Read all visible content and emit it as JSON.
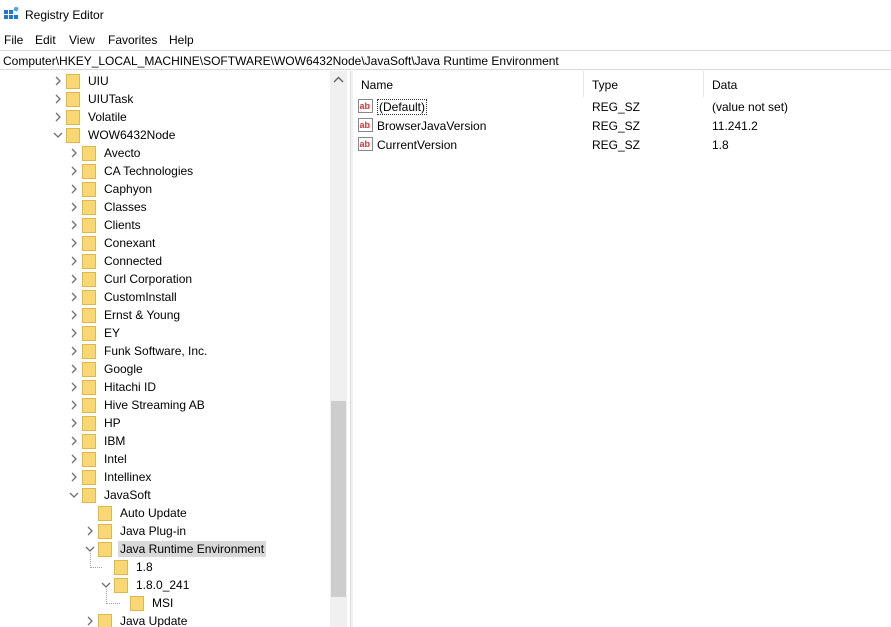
{
  "window": {
    "title": "Registry Editor"
  },
  "menu": [
    "File",
    "Edit",
    "View",
    "Favorites",
    "Help"
  ],
  "address": "Computer\\HKEY_LOCAL_MACHINE\\SOFTWARE\\WOW6432Node\\JavaSoft\\Java Runtime Environment",
  "tree": [
    {
      "label": "UIU",
      "depth": 0,
      "expander": "collapsed"
    },
    {
      "label": "UIUTask",
      "depth": 0,
      "expander": "collapsed"
    },
    {
      "label": "Volatile",
      "depth": 0,
      "expander": "collapsed"
    },
    {
      "label": "WOW6432Node",
      "depth": 0,
      "expander": "expanded"
    },
    {
      "label": "Avecto",
      "depth": 1,
      "expander": "collapsed"
    },
    {
      "label": "CA Technologies",
      "depth": 1,
      "expander": "collapsed"
    },
    {
      "label": "Caphyon",
      "depth": 1,
      "expander": "collapsed"
    },
    {
      "label": "Classes",
      "depth": 1,
      "expander": "collapsed"
    },
    {
      "label": "Clients",
      "depth": 1,
      "expander": "collapsed"
    },
    {
      "label": "Conexant",
      "depth": 1,
      "expander": "collapsed"
    },
    {
      "label": "Connected",
      "depth": 1,
      "expander": "collapsed"
    },
    {
      "label": "Curl Corporation",
      "depth": 1,
      "expander": "collapsed"
    },
    {
      "label": "CustomInstall",
      "depth": 1,
      "expander": "collapsed"
    },
    {
      "label": "Ernst & Young",
      "depth": 1,
      "expander": "collapsed"
    },
    {
      "label": "EY",
      "depth": 1,
      "expander": "collapsed"
    },
    {
      "label": "Funk Software, Inc.",
      "depth": 1,
      "expander": "collapsed"
    },
    {
      "label": "Google",
      "depth": 1,
      "expander": "collapsed"
    },
    {
      "label": "Hitachi ID",
      "depth": 1,
      "expander": "collapsed"
    },
    {
      "label": "Hive Streaming AB",
      "depth": 1,
      "expander": "collapsed"
    },
    {
      "label": "HP",
      "depth": 1,
      "expander": "collapsed"
    },
    {
      "label": "IBM",
      "depth": 1,
      "expander": "collapsed"
    },
    {
      "label": "Intel",
      "depth": 1,
      "expander": "collapsed"
    },
    {
      "label": "Intellinex",
      "depth": 1,
      "expander": "collapsed"
    },
    {
      "label": "JavaSoft",
      "depth": 1,
      "expander": "expanded"
    },
    {
      "label": "Auto Update",
      "depth": 2,
      "expander": "none"
    },
    {
      "label": "Java Plug-in",
      "depth": 2,
      "expander": "collapsed"
    },
    {
      "label": "Java Runtime Environment",
      "depth": 2,
      "expander": "expanded",
      "selected": true
    },
    {
      "label": "1.8",
      "depth": 3,
      "expander": "none"
    },
    {
      "label": "1.8.0_241",
      "depth": 3,
      "expander": "expanded"
    },
    {
      "label": "MSI",
      "depth": 4,
      "expander": "none"
    },
    {
      "label": "Java Update",
      "depth": 2,
      "expander": "collapsed"
    }
  ],
  "columns": {
    "name": "Name",
    "type": "Type",
    "data": "Data"
  },
  "values": [
    {
      "name": "(Default)",
      "type": "REG_SZ",
      "data": "(value not set)",
      "focused": true
    },
    {
      "name": "BrowserJavaVersion",
      "type": "REG_SZ",
      "data": "11.241.2"
    },
    {
      "name": "CurrentVersion",
      "type": "REG_SZ",
      "data": "1.8"
    }
  ],
  "colors": {
    "folder": "#f8d775",
    "folder_dark": "#e0b84a",
    "selection": "#d9d9d9",
    "value_icon_red": "#d13438"
  }
}
